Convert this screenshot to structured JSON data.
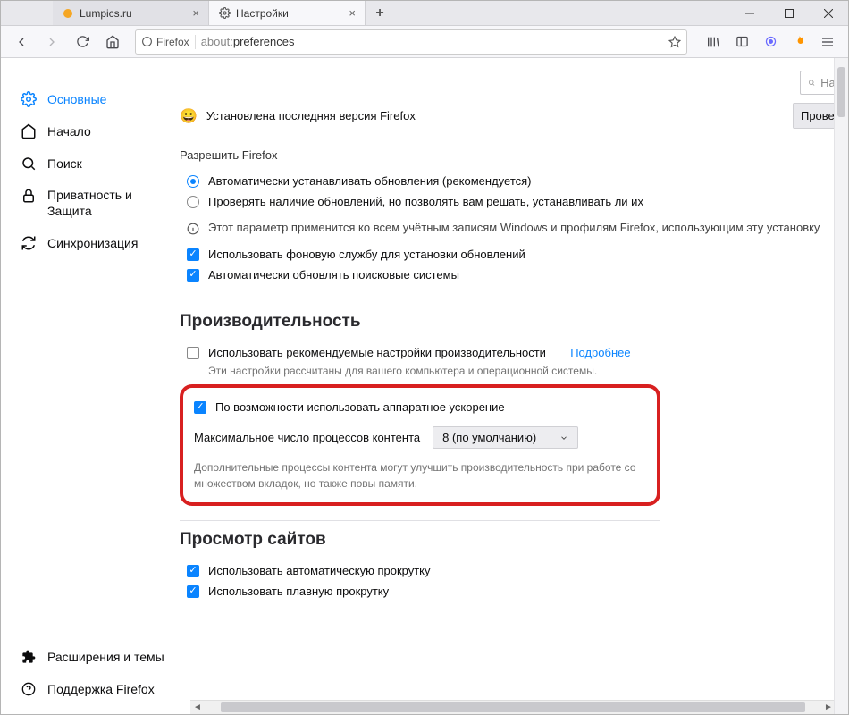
{
  "tabs": [
    {
      "title": "Lumpics.ru",
      "favicon": "circle-orange"
    },
    {
      "title": "Настройки",
      "favicon": "gear"
    }
  ],
  "window": {
    "newtab_tooltip": "+"
  },
  "urlbar": {
    "identity_label": "Firefox",
    "protocol": "about:",
    "page": "preferences"
  },
  "sidebar": {
    "items": [
      {
        "icon": "gear",
        "label": "Основные",
        "active": true
      },
      {
        "icon": "home",
        "label": "Начало"
      },
      {
        "icon": "search",
        "label": "Поиск"
      },
      {
        "icon": "lock",
        "label": "Приватность и Защита",
        "twoline": true
      },
      {
        "icon": "sync",
        "label": "Синхронизация"
      }
    ],
    "bottom": [
      {
        "icon": "puzzle",
        "label": "Расширения и темы"
      },
      {
        "icon": "help",
        "label": "Поддержка Firefox"
      }
    ]
  },
  "search": {
    "placeholder": "Най"
  },
  "status": {
    "text": "Установлена последняя версия Firefox",
    "check_button": "Провер"
  },
  "updates": {
    "allow_label": "Разрешить Firefox",
    "radio_auto": "Автоматически устанавливать обновления (рекомендуется)",
    "radio_check": "Проверять наличие обновлений, но позволять вам решать, устанавливать ли их",
    "note": "Этот параметр применится ко всем учётным записям Windows и профилям Firefox, использующим эту установку",
    "bg_service": "Использовать фоновую службу для установки обновлений",
    "auto_search": "Автоматически обновлять поисковые системы"
  },
  "performance": {
    "heading": "Производительность",
    "use_recommended": "Использовать рекомендуемые настройки производительности",
    "learn_more": "Подробнее",
    "desc": "Эти настройки рассчитаны для вашего компьютера и операционной системы.",
    "hw_accel": "По возможности использовать аппаратное ускорение",
    "processes_label": "Максимальное число процессов контента",
    "processes_value": "8 (по умолчанию)",
    "processes_desc": "Дополнительные процессы контента могут улучшить производительность при работе со множеством вкладок, но также повы памяти."
  },
  "browsing": {
    "heading": "Просмотр сайтов",
    "auto_scroll": "Использовать автоматическую прокрутку",
    "smooth_scroll": "Использовать плавную прокрутку"
  }
}
